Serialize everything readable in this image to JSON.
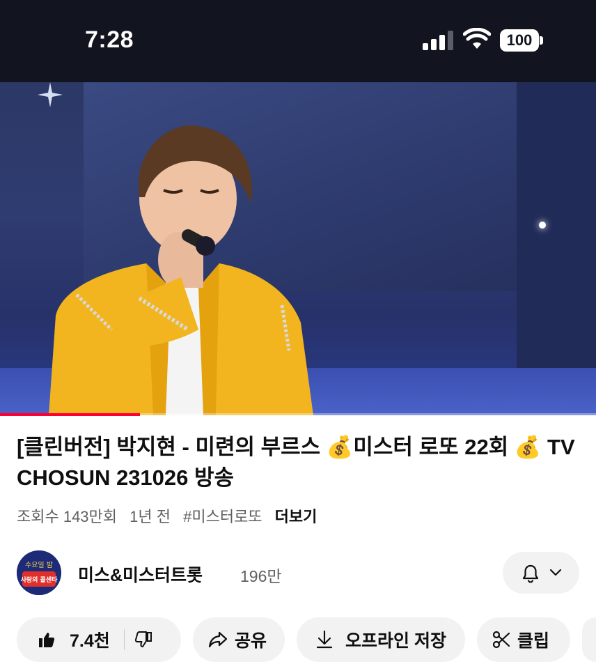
{
  "status_bar": {
    "time": "7:28",
    "battery": "100"
  },
  "video": {
    "progress": 0.235,
    "accent": "#ff0033"
  },
  "title": "[클린버전] 박지현 - 미련의 부르스 💰미스터 로또 22회 💰 TV CHOSUN 231026 방송",
  "meta": {
    "views": "조회수 143만회",
    "age": "1년 전",
    "hashtag": "#미스터로또",
    "more": "더보기"
  },
  "channel": {
    "name": "미스&미스터트롯",
    "subscribers": "196만",
    "avatar_text_top": "수요일 밤",
    "avatar_text_bottom": "사랑의 콜센타"
  },
  "actions": {
    "like_count": "7.4천",
    "share": "공유",
    "download": "오프라인 저장",
    "clip": "클립"
  },
  "icons": [
    "signal-icon",
    "wifi-icon",
    "battery-icon",
    "bell-icon",
    "chevron-down-icon",
    "like-icon",
    "dislike-icon",
    "share-icon",
    "download-icon",
    "scissors-icon"
  ]
}
